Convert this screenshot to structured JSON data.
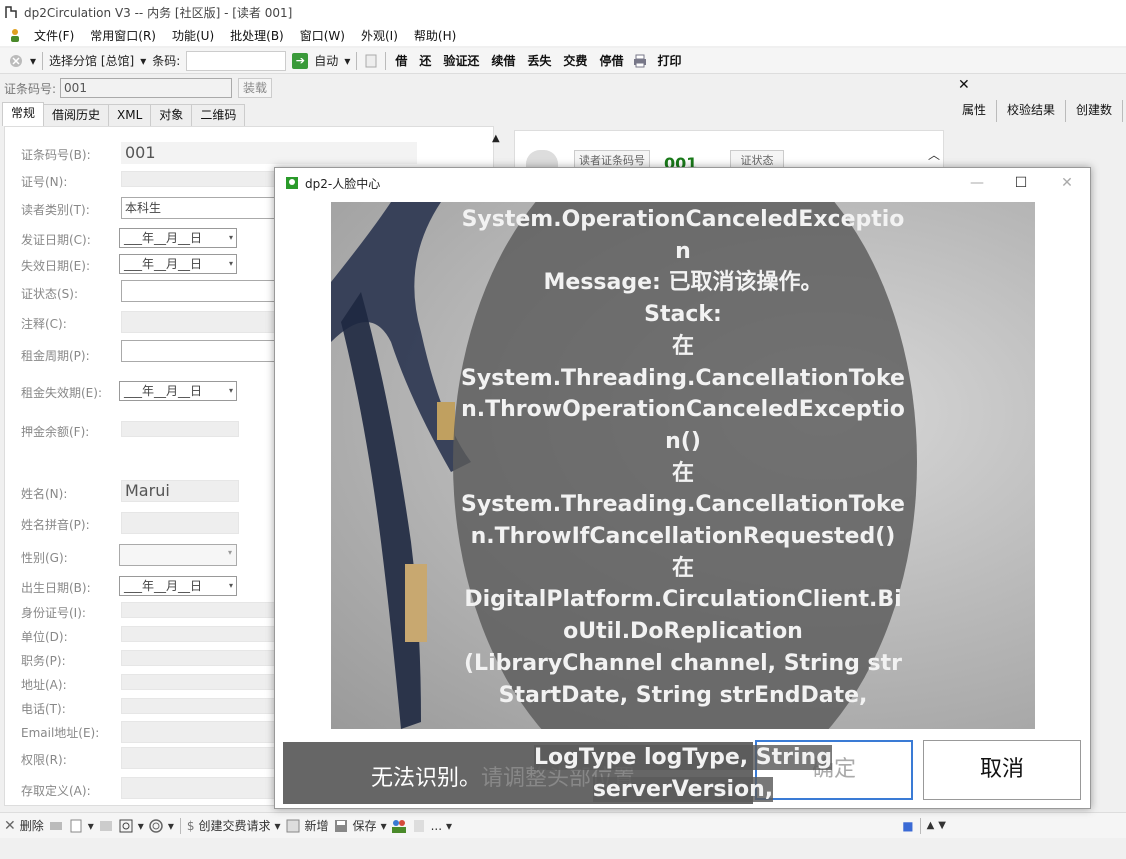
{
  "window": {
    "title": "dp2Circulation V3 -- 内务 [社区版] - [读者 001]"
  },
  "menu": [
    "文件(F)",
    "常用窗口(R)",
    "功能(U)",
    "批处理(B)",
    "窗口(W)",
    "外观(I)",
    "帮助(H)"
  ],
  "toolbar": {
    "branch_label": "选择分馆 [总馆]",
    "barcode_label": "条码:",
    "auto_label": "自动",
    "actions": [
      "借",
      "还",
      "验证还",
      "续借",
      "丢失",
      "交费",
      "停借"
    ],
    "print_label": "打印"
  },
  "barcode_row": {
    "label": "证条码号:",
    "value": "001",
    "load_button": "装载"
  },
  "tabs": [
    "常规",
    "借阅历史",
    "XML",
    "对象",
    "二维码"
  ],
  "form": {
    "fields": [
      {
        "label": "证条码号(B):",
        "value": "001"
      },
      {
        "label": "证号(N):",
        "value": ""
      },
      {
        "label": "读者类别(T):",
        "value": "本科生"
      },
      {
        "label": "发证日期(C):",
        "value": "___年__月__日"
      },
      {
        "label": "失效日期(E):",
        "value": "___年__月__日"
      },
      {
        "label": "证状态(S):",
        "value": ""
      },
      {
        "label": "注释(C):",
        "value": ""
      },
      {
        "label": "租金周期(P):",
        "value": ""
      },
      {
        "label": "租金失效期(E):",
        "value": "___年__月__日"
      },
      {
        "label": "押金余额(F):",
        "value": ""
      },
      {
        "label": "姓名(N):",
        "value": "Marui"
      },
      {
        "label": "姓名拼音(P):",
        "value": ""
      },
      {
        "label": "性别(G):",
        "value": ""
      },
      {
        "label": "出生日期(B):",
        "value": "___年__月__日"
      },
      {
        "label": "身份证号(I):",
        "value": ""
      },
      {
        "label": "单位(D):",
        "value": ""
      },
      {
        "label": "职务(P):",
        "value": ""
      },
      {
        "label": "地址(A):",
        "value": ""
      },
      {
        "label": "电话(T):",
        "value": ""
      },
      {
        "label": "Email地址(E):",
        "value": ""
      },
      {
        "label": "权限(R):",
        "value": ""
      },
      {
        "label": "存取定义(A):",
        "value": ""
      }
    ]
  },
  "card": {
    "barcode_label": "读者证条码号",
    "barcode_value": "001",
    "status_label": "证状态"
  },
  "side_panel": {
    "tabs": [
      "属性",
      "校验结果",
      "创建数"
    ]
  },
  "bottom_toolbar": {
    "delete_label": "删除",
    "create_fee_label": "创建交费请求",
    "new_label": "新增",
    "save_label": "保存",
    "more_label": "..."
  },
  "dialog": {
    "title": "dp2-人脸中心",
    "message": "System.OperationCanceledException\nMessage: 已取消该操作。\nStack:\n在\nSystem.Threading.CancellationToken.ThrowOperationCanceledException()\n在\nSystem.Threading.CancellationToken.ThrowIfCancellationRequested()\n在\nDigitalPlatform.CirculationClient.BioUtil.DoReplication\n(LibraryChannel channel, String strStartDate, String strEndDate,",
    "message_overflow_1": "LogType logType, String",
    "message_overflow_2": "serverVersion,",
    "status_text": "无法识别。",
    "status_hint": "请调整头部位置",
    "ok_label": "确定",
    "cancel_label": "取消"
  }
}
